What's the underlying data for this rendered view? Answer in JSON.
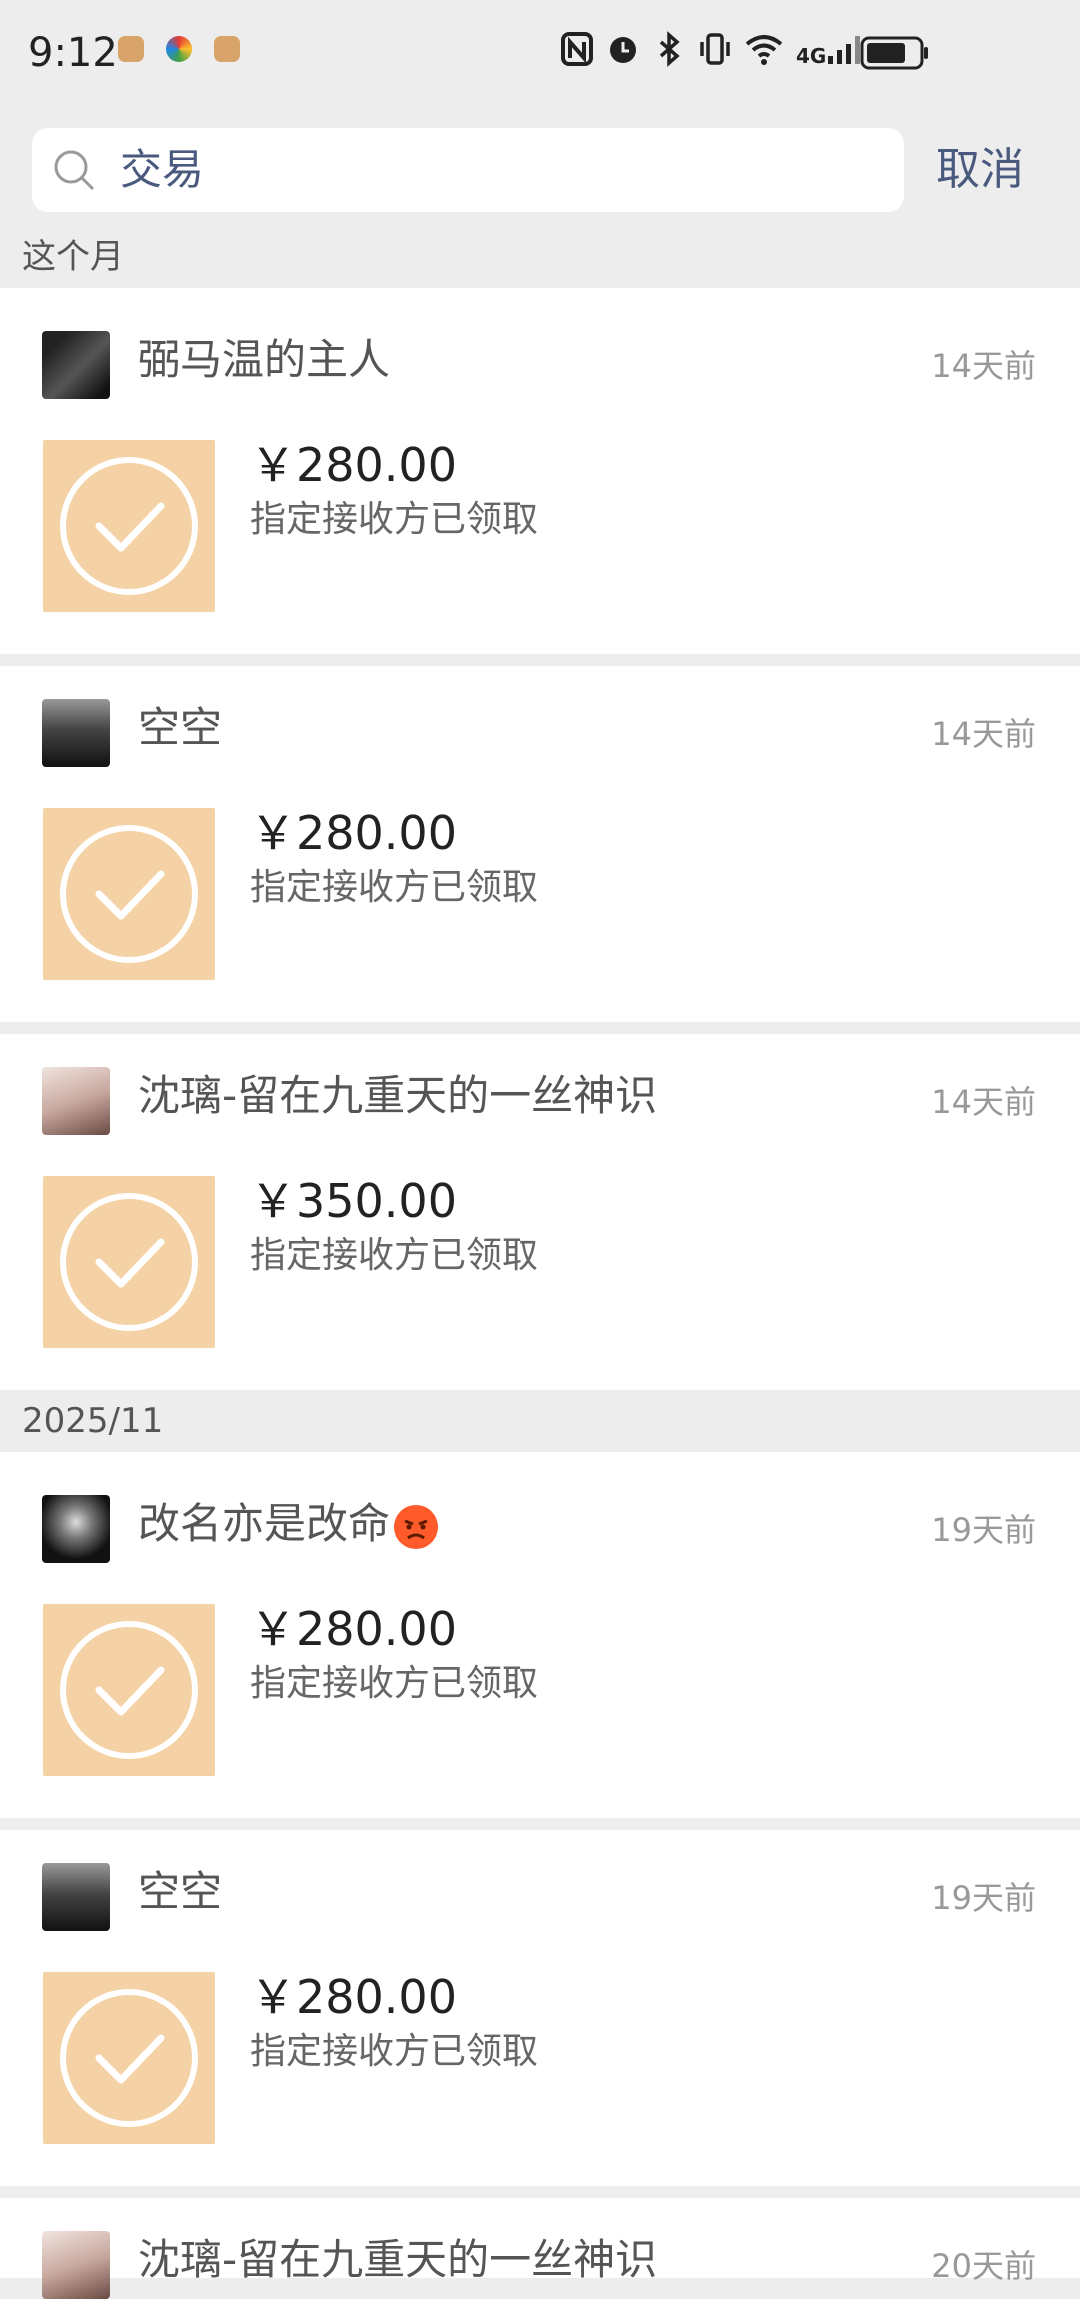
{
  "status_bar": {
    "time": "9:12",
    "network": "4G",
    "icons": [
      "nfc-icon",
      "alarm-icon",
      "bluetooth-icon",
      "vibrate-icon",
      "wifi-icon",
      "signal-icon",
      "battery-icon"
    ]
  },
  "search": {
    "query": "交易",
    "cancel_label": "取消"
  },
  "sections": [
    {
      "header": "这个月"
    },
    {
      "header": "2025/11"
    }
  ],
  "transactions": [
    {
      "name": "弼马温的主人",
      "time": "14天前",
      "amount": "￥280.00",
      "status": "指定接收方已领取"
    },
    {
      "name": "空空",
      "time": "14天前",
      "amount": "￥280.00",
      "status": "指定接收方已领取"
    },
    {
      "name": "沈璃-留在九重天的一丝神识",
      "time": "14天前",
      "amount": "￥350.00",
      "status": "指定接收方已领取"
    },
    {
      "name": "改名亦是改命",
      "time": "19天前",
      "amount": "￥280.00",
      "status": "指定接收方已领取"
    },
    {
      "name": "空空",
      "time": "19天前",
      "amount": "￥280.00",
      "status": "指定接收方已领取"
    },
    {
      "name": "沈璃-留在九重天的一丝神识",
      "time": "20天前"
    }
  ],
  "colors": {
    "accent": "#4a5a7e",
    "thumb": "#f5d2a6",
    "background": "#ededed"
  }
}
